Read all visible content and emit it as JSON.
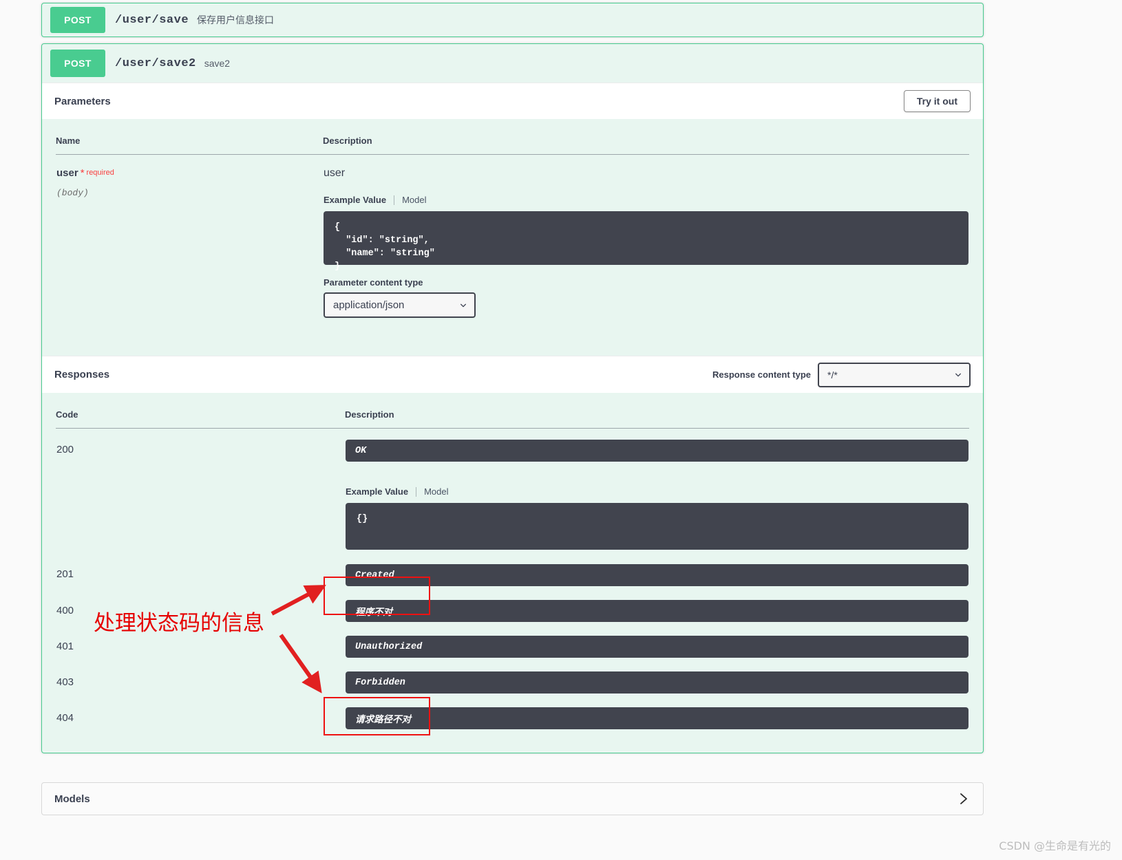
{
  "operations": [
    {
      "method": "POST",
      "path": "/user/save",
      "summary": "保存用户信息接口"
    },
    {
      "method": "POST",
      "path": "/user/save2",
      "summary": "save2"
    }
  ],
  "parameters_section": {
    "title": "Parameters",
    "try_it_out_label": "Try it out",
    "headers": {
      "name": "Name",
      "description": "Description"
    },
    "rows": [
      {
        "name": "user",
        "required_star": "*",
        "required_label": "required",
        "in": "(body)",
        "description": "user",
        "example_tab": "Example Value",
        "model_tab": "Model",
        "example_code": "{\n  \"id\": \"string\",\n  \"name\": \"string\"\n}",
        "content_type_label": "Parameter content type",
        "content_type_value": "application/json"
      }
    ]
  },
  "responses_section": {
    "title": "Responses",
    "content_type_label": "Response content type",
    "content_type_value": "*/*",
    "headers": {
      "code": "Code",
      "description": "Description"
    },
    "rows": [
      {
        "code": "200",
        "description": "OK",
        "example_tab": "Example Value",
        "model_tab": "Model",
        "example_code": "{}"
      },
      {
        "code": "201",
        "description": "Created"
      },
      {
        "code": "400",
        "description": "程序不对"
      },
      {
        "code": "401",
        "description": "Unauthorized"
      },
      {
        "code": "403",
        "description": "Forbidden"
      },
      {
        "code": "404",
        "description": "请求路径不对"
      }
    ]
  },
  "models_section": {
    "title": "Models",
    "expand_icon": "chevron-right-icon"
  },
  "annotations": {
    "note_text": "处理状态码的信息",
    "highlight_color": "#ee1111",
    "arrow_color": "#e12020"
  },
  "watermark": "CSDN @生命是有光的",
  "colors": {
    "method_post": "#49cc90",
    "panel_bg": "#e8f6f0",
    "code_bg": "#41444e",
    "required": "#f93e3e"
  }
}
